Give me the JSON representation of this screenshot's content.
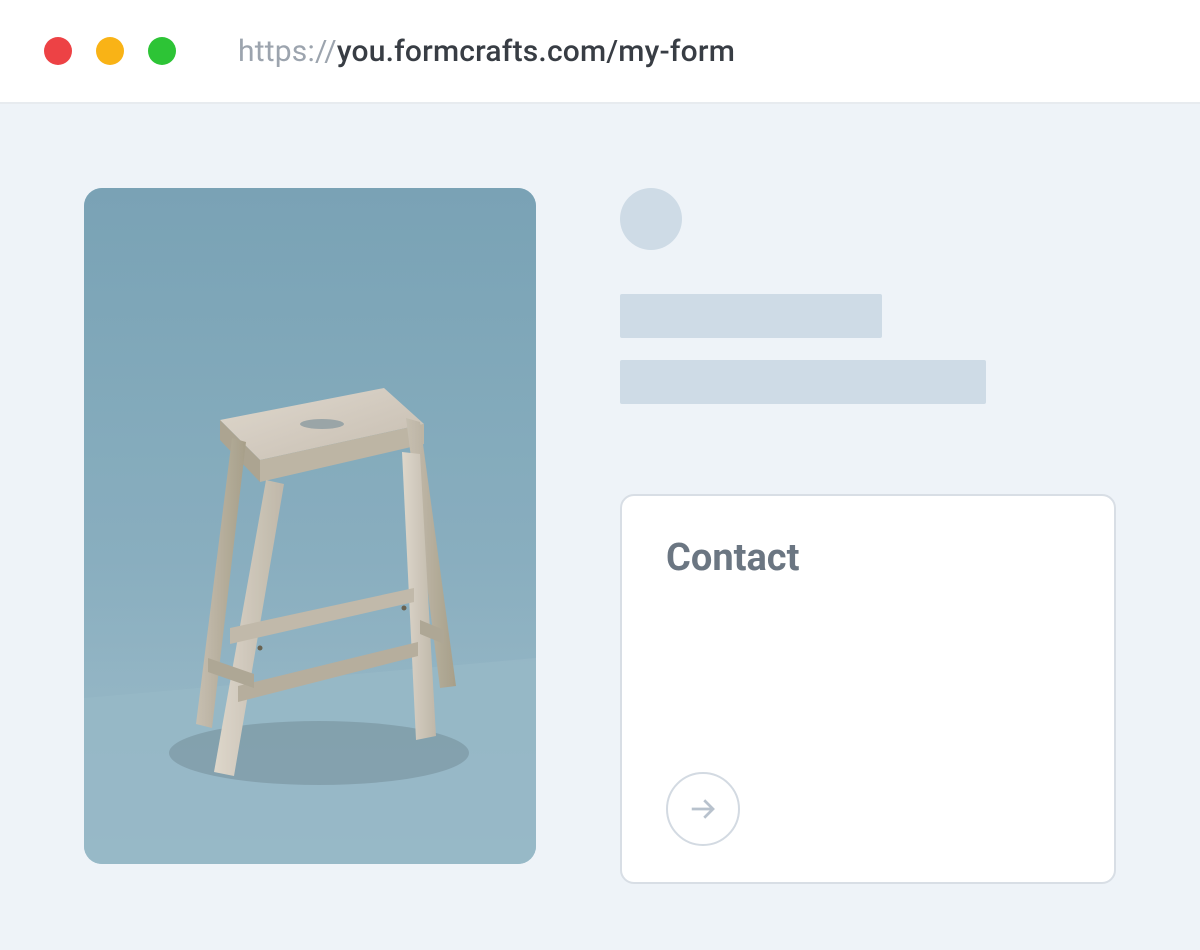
{
  "browser": {
    "url_scheme": "https://",
    "url_host_path": "you.formcrafts.com/my-form"
  },
  "form": {
    "title": "Contact"
  },
  "colors": {
    "page_bg": "#eef3f8",
    "skeleton": "#cedbe6",
    "card_border": "#d8dee5",
    "text_muted": "#6b7682",
    "arrow": "#b8c2cd",
    "red": "#ed4245",
    "yellow": "#f9b316",
    "green": "#2dc436"
  },
  "icons": {
    "submit": "arrow-right-icon"
  }
}
